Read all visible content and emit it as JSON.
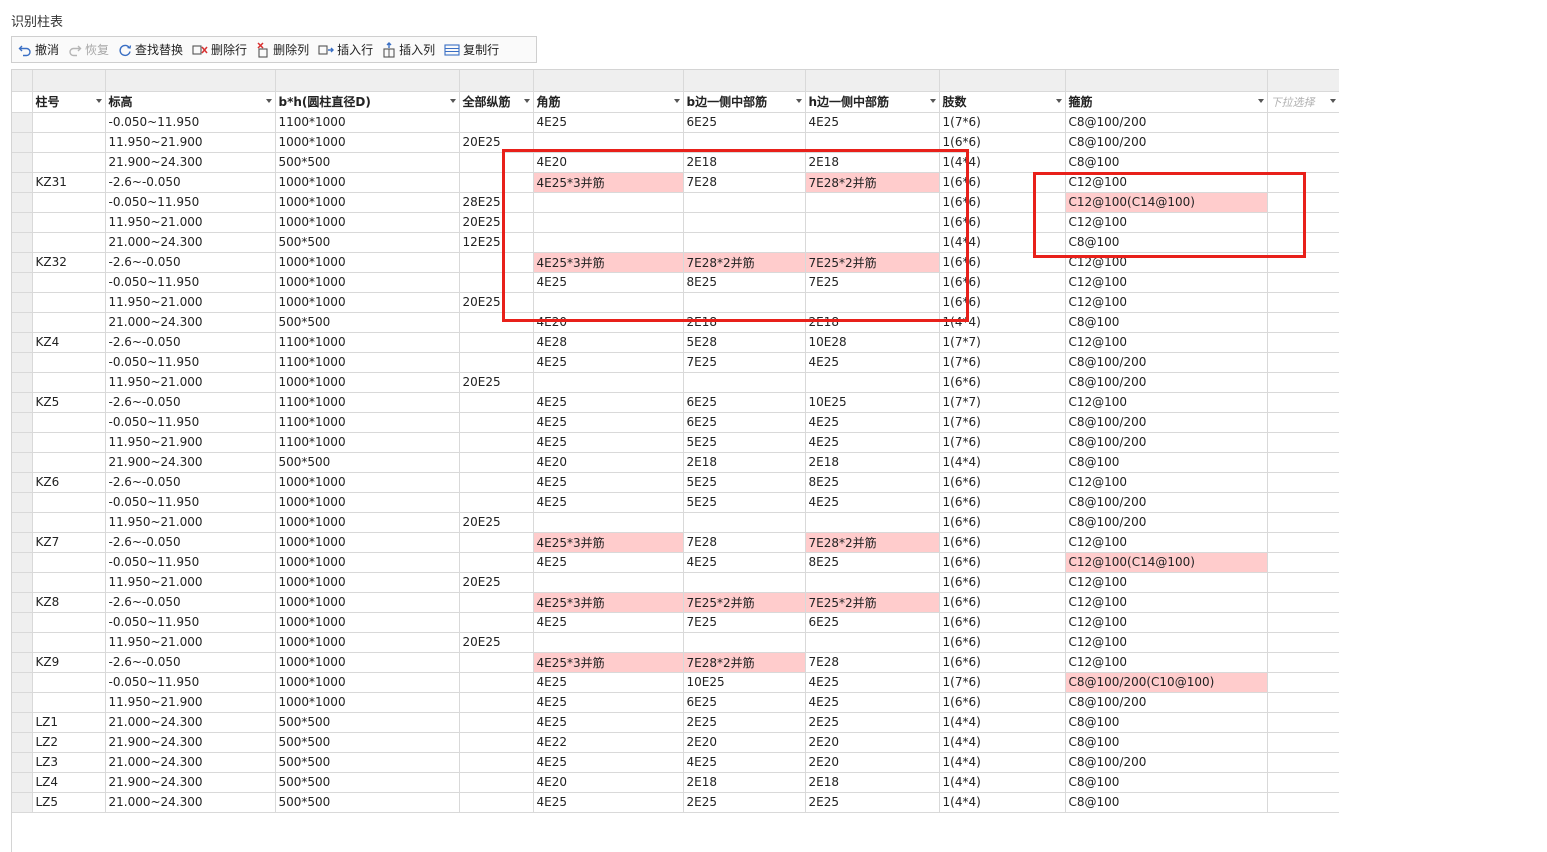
{
  "window": {
    "title": "识别柱表"
  },
  "toolbar": {
    "undo": "撤消",
    "redo": "恢复",
    "find_replace": "查找替换",
    "delete_row": "删除行",
    "delete_col": "删除列",
    "insert_row": "插入行",
    "insert_col": "插入列",
    "copy_row": "复制行"
  },
  "columns": [
    "柱号",
    "标高",
    "b*h(圆柱直径D)",
    "全部纵筋",
    "角筋",
    "b边一侧中部筋",
    "h边一侧中部筋",
    "肢数",
    "箍筋",
    "下拉选择"
  ],
  "rows": [
    [
      "",
      "-0.050~11.950",
      "1100*1000",
      "",
      "4E25",
      "6E25",
      "4E25",
      "1(7*6)",
      "C8@100/200"
    ],
    [
      "",
      "11.950~21.900",
      "1000*1000",
      "20E25",
      "",
      "",
      "",
      "1(6*6)",
      "C8@100/200"
    ],
    [
      "",
      "21.900~24.300",
      "500*500",
      "",
      "4E20",
      "2E18",
      "2E18",
      "1(4*4)",
      "C8@100"
    ],
    [
      "KZ31",
      "-2.6~-0.050",
      "1000*1000",
      "",
      "4E25*3并筋",
      "7E28",
      "7E28*2并筋",
      "1(6*6)",
      "C12@100"
    ],
    [
      "",
      "-0.050~11.950",
      "1000*1000",
      "28E25",
      "",
      "",
      "",
      "1(6*6)",
      "C12@100(C14@100)"
    ],
    [
      "",
      "11.950~21.000",
      "1000*1000",
      "20E25",
      "",
      "",
      "",
      "1(6*6)",
      "C12@100"
    ],
    [
      "",
      "21.000~24.300",
      "500*500",
      "12E25",
      "",
      "",
      "",
      "1(4*4)",
      "C8@100"
    ],
    [
      "KZ32",
      "-2.6~-0.050",
      "1000*1000",
      "",
      "4E25*3并筋",
      "7E28*2并筋",
      "7E25*2并筋",
      "1(6*6)",
      "C12@100"
    ],
    [
      "",
      "-0.050~11.950",
      "1000*1000",
      "",
      "4E25",
      "8E25",
      "7E25",
      "1(6*6)",
      "C12@100"
    ],
    [
      "",
      "11.950~21.000",
      "1000*1000",
      "20E25",
      "",
      "",
      "",
      "1(6*6)",
      "C12@100"
    ],
    [
      "",
      "21.000~24.300",
      "500*500",
      "",
      "4E20",
      "2E18",
      "2E18",
      "1(4*4)",
      "C8@100"
    ],
    [
      "KZ4",
      "-2.6~-0.050",
      "1100*1000",
      "",
      "4E28",
      "5E28",
      "10E28",
      "1(7*7)",
      "C12@100"
    ],
    [
      "",
      "-0.050~11.950",
      "1100*1000",
      "",
      "4E25",
      "7E25",
      "4E25",
      "1(7*6)",
      "C8@100/200"
    ],
    [
      "",
      "11.950~21.000",
      "1000*1000",
      "20E25",
      "",
      "",
      "",
      "1(6*6)",
      "C8@100/200"
    ],
    [
      "KZ5",
      "-2.6~-0.050",
      "1100*1000",
      "",
      "4E25",
      "6E25",
      "10E25",
      "1(7*7)",
      "C12@100"
    ],
    [
      "",
      "-0.050~11.950",
      "1100*1000",
      "",
      "4E25",
      "6E25",
      "4E25",
      "1(7*6)",
      "C8@100/200"
    ],
    [
      "",
      "11.950~21.900",
      "1100*1000",
      "",
      "4E25",
      "5E25",
      "4E25",
      "1(7*6)",
      "C8@100/200"
    ],
    [
      "",
      "21.900~24.300",
      "500*500",
      "",
      "4E20",
      "2E18",
      "2E18",
      "1(4*4)",
      "C8@100"
    ],
    [
      "KZ6",
      "-2.6~-0.050",
      "1000*1000",
      "",
      "4E25",
      "5E25",
      "8E25",
      "1(6*6)",
      "C12@100"
    ],
    [
      "",
      "-0.050~11.950",
      "1000*1000",
      "",
      "4E25",
      "5E25",
      "4E25",
      "1(6*6)",
      "C8@100/200"
    ],
    [
      "",
      "11.950~21.000",
      "1000*1000",
      "20E25",
      "",
      "",
      "",
      "1(6*6)",
      "C8@100/200"
    ],
    [
      "KZ7",
      "-2.6~-0.050",
      "1000*1000",
      "",
      "4E25*3并筋",
      "7E28",
      "7E28*2并筋",
      "1(6*6)",
      "C12@100"
    ],
    [
      "",
      "-0.050~11.950",
      "1000*1000",
      "",
      "4E25",
      "4E25",
      "8E25",
      "1(6*6)",
      "C12@100(C14@100)"
    ],
    [
      "",
      "11.950~21.000",
      "1000*1000",
      "20E25",
      "",
      "",
      "",
      "1(6*6)",
      "C12@100"
    ],
    [
      "KZ8",
      "-2.6~-0.050",
      "1000*1000",
      "",
      "4E25*3并筋",
      "7E25*2并筋",
      "7E25*2并筋",
      "1(6*6)",
      "C12@100"
    ],
    [
      "",
      "-0.050~11.950",
      "1000*1000",
      "",
      "4E25",
      "7E25",
      "6E25",
      "1(6*6)",
      "C12@100"
    ],
    [
      "",
      "11.950~21.000",
      "1000*1000",
      "20E25",
      "",
      "",
      "",
      "1(6*6)",
      "C12@100"
    ],
    [
      "KZ9",
      "-2.6~-0.050",
      "1000*1000",
      "",
      "4E25*3并筋",
      "7E28*2并筋",
      "7E28",
      "1(6*6)",
      "C12@100"
    ],
    [
      "",
      "-0.050~11.950",
      "1000*1000",
      "",
      "4E25",
      "10E25",
      "4E25",
      "1(7*6)",
      "C8@100/200(C10@100)"
    ],
    [
      "",
      "11.950~21.900",
      "1000*1000",
      "",
      "4E25",
      "6E25",
      "4E25",
      "1(6*6)",
      "C8@100/200"
    ],
    [
      "LZ1",
      "21.000~24.300",
      "500*500",
      "",
      "4E25",
      "2E25",
      "2E25",
      "1(4*4)",
      "C8@100"
    ],
    [
      "LZ2",
      "21.900~24.300",
      "500*500",
      "",
      "4E22",
      "2E20",
      "2E20",
      "1(4*4)",
      "C8@100"
    ],
    [
      "LZ3",
      "21.000~24.300",
      "500*500",
      "",
      "4E25",
      "4E25",
      "2E20",
      "1(4*4)",
      "C8@100/200"
    ],
    [
      "LZ4",
      "21.900~24.300",
      "500*500",
      "",
      "4E20",
      "2E18",
      "2E18",
      "1(4*4)",
      "C8@100"
    ],
    [
      "LZ5",
      "21.000~24.300",
      "500*500",
      "",
      "4E25",
      "2E25",
      "2E25",
      "1(4*4)",
      "C8@100"
    ]
  ],
  "highlight_color": "#ffcccc",
  "annotation_color": "#e8201a"
}
